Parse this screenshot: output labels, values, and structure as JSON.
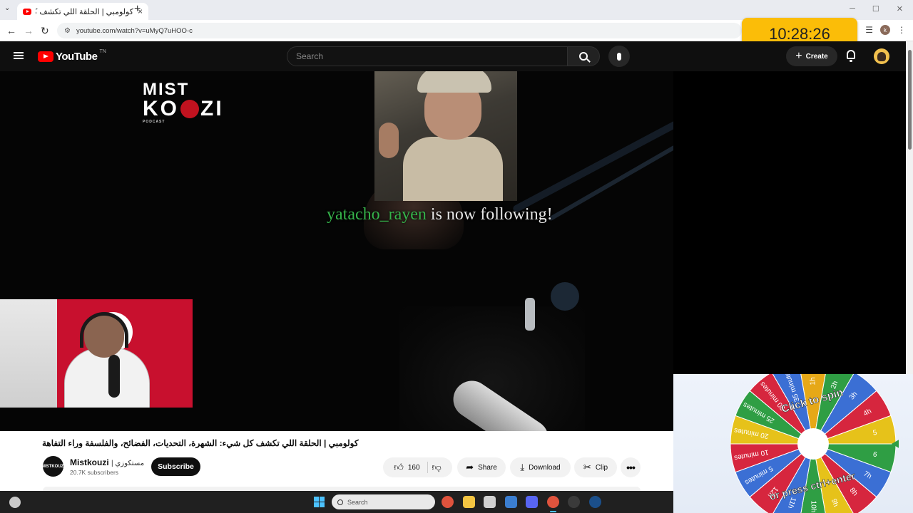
{
  "browser": {
    "tab_title": "كولومبي | الحلقة اللي تكشف كل",
    "tab_close": "×",
    "new_tab": "+",
    "tab_list": "⌄",
    "url": "youtube.com/watch?v=uMyQ7uHOO-c",
    "profile_initial": "k"
  },
  "clock": {
    "time": "10:28:26"
  },
  "youtube": {
    "logo_text": "YouTube",
    "logo_region": "TN",
    "search_placeholder": "Search",
    "create_label": "Create"
  },
  "video": {
    "brand": {
      "line1": "MIST",
      "line2a": "KO",
      "line2b": "ZI",
      "line3": "PODCAST"
    },
    "follow_user": "yatacho_rayen",
    "follow_msg": " is now following!"
  },
  "below_video": {
    "title": "كولومبي | الحلقة اللي تكشف كل شيء: الشهرة، التحديات، الفضائح، والفلسفة وراء التفاهة",
    "channel_avatar_text": "MISTKOUZI",
    "channel_name": "Mistkouzi",
    "channel_alt_name": "| مستكوزي",
    "subscribers": "20.7K subscribers",
    "subscribe_label": "Subscribe",
    "like_count": "160",
    "share_label": "Share",
    "download_label": "Download",
    "clip_label": "Clip",
    "more_label": "•••"
  },
  "wheel": {
    "segments": [
      {
        "label": "1h",
        "color": "#e6a817"
      },
      {
        "label": "2h",
        "color": "#2f9e44"
      },
      {
        "label": "3h",
        "color": "#3b6fd4"
      },
      {
        "label": "4h",
        "color": "#d6263e"
      },
      {
        "label": "5",
        "color": "#e6c21a"
      },
      {
        "label": "6",
        "color": "#2f9e44"
      },
      {
        "label": "7h",
        "color": "#3b6fd4"
      },
      {
        "label": "8h",
        "color": "#d6263e"
      },
      {
        "label": "9h",
        "color": "#e6c21a"
      },
      {
        "label": "10h",
        "color": "#2f9e44"
      },
      {
        "label": "11h",
        "color": "#3b6fd4"
      },
      {
        "label": "12h",
        "color": "#d6263e"
      },
      {
        "label": "5 minutes",
        "color": "#3b6fd4"
      },
      {
        "label": "10 minutes",
        "color": "#d6263e"
      },
      {
        "label": "20 minutes",
        "color": "#e6c21a"
      },
      {
        "label": "25 minutes",
        "color": "#2f9e44"
      },
      {
        "label": "30 minutes",
        "color": "#d6263e"
      },
      {
        "label": "35 minutes",
        "color": "#3b6fd4"
      }
    ],
    "top_text": "Click to spin",
    "bottom_text": "or press ctrl+enter",
    "pointer_color": "#2f9e44"
  },
  "taskbar": {
    "search_placeholder": "Search",
    "icons": [
      {
        "name": "chrome-icon",
        "color": "#e0533d"
      },
      {
        "name": "file-explorer-icon",
        "color": "#f4c542"
      },
      {
        "name": "calculator-icon",
        "color": "#d0d0d0"
      },
      {
        "name": "mail-icon",
        "color": "#3b7ed0"
      },
      {
        "name": "discord-icon",
        "color": "#5865f2"
      },
      {
        "name": "chrome-active-icon",
        "color": "#e0533d"
      },
      {
        "name": "obs-icon",
        "color": "#3a3a3a"
      },
      {
        "name": "steam-icon",
        "color": "#1b4f8a"
      }
    ]
  }
}
